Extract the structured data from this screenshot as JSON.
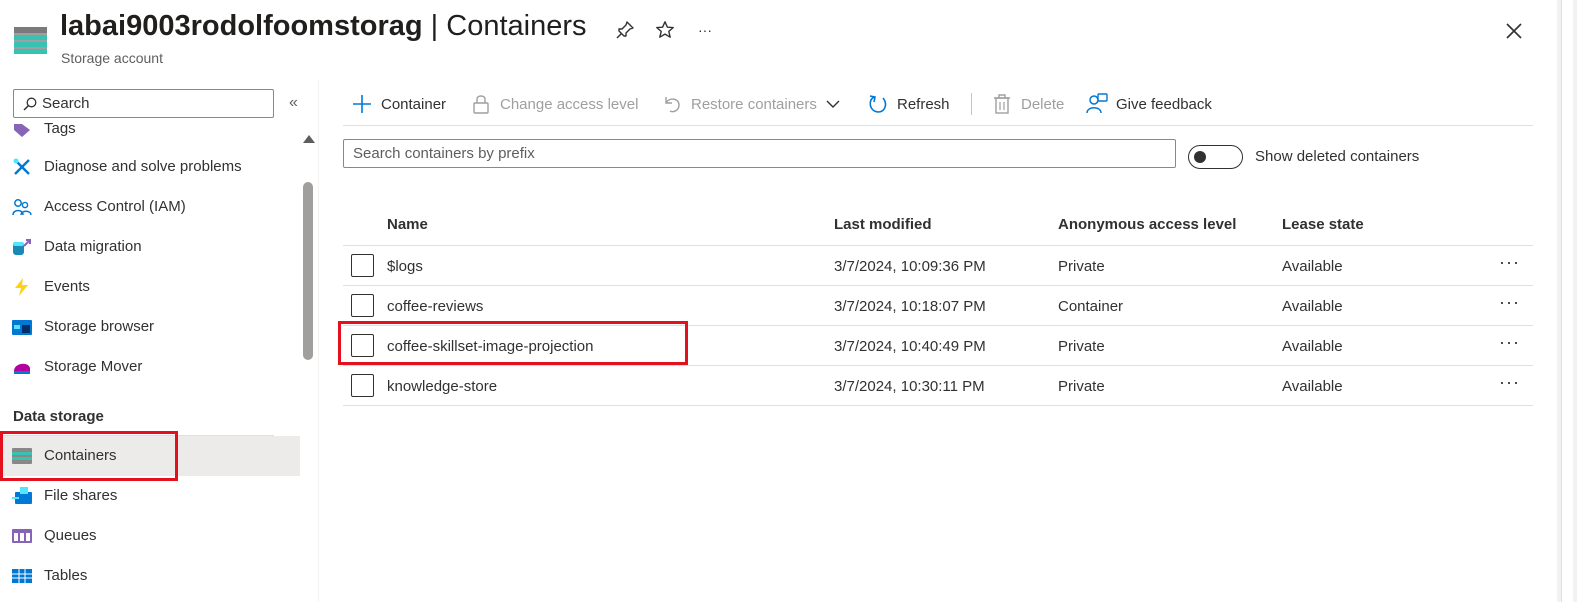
{
  "header": {
    "resource_name": "labai9003rodolfoomstorag",
    "separator": " | ",
    "page_title": "Containers",
    "subtitle": "Storage account",
    "icons": [
      "storage-icon",
      "pin-icon",
      "star-icon",
      "more-icon",
      "close-icon"
    ]
  },
  "sidebar": {
    "search_placeholder": "Search",
    "partial_item": "Tags",
    "items": [
      {
        "label": "Diagnose and solve problems",
        "icon": "wrench-icon"
      },
      {
        "label": "Access Control (IAM)",
        "icon": "people-icon"
      },
      {
        "label": "Data migration",
        "icon": "migration-icon"
      },
      {
        "label": "Events",
        "icon": "lightning-icon"
      },
      {
        "label": "Storage browser",
        "icon": "storage-browser-icon"
      },
      {
        "label": "Storage Mover",
        "icon": "storage-mover-icon"
      }
    ],
    "section_title": "Data storage",
    "data_storage_items": [
      {
        "label": "Containers",
        "icon": "containers-icon",
        "selected": true
      },
      {
        "label": "File shares",
        "icon": "file-shares-icon"
      },
      {
        "label": "Queues",
        "icon": "queues-icon"
      },
      {
        "label": "Tables",
        "icon": "tables-icon"
      }
    ]
  },
  "toolbar": {
    "add_container": "Container",
    "change_access": "Change access level",
    "restore": "Restore containers",
    "refresh": "Refresh",
    "delete": "Delete",
    "feedback": "Give feedback"
  },
  "filter": {
    "prefix_placeholder": "Search containers by prefix",
    "show_deleted_label": "Show deleted containers",
    "show_deleted": false
  },
  "table": {
    "columns": [
      "Name",
      "Last modified",
      "Anonymous access level",
      "Lease state"
    ],
    "rows": [
      {
        "name": "$logs",
        "modified": "3/7/2024, 10:09:36 PM",
        "access": "Private",
        "lease": "Available"
      },
      {
        "name": "coffee-reviews",
        "modified": "3/7/2024, 10:18:07 PM",
        "access": "Container",
        "lease": "Available"
      },
      {
        "name": "coffee-skillset-image-projection",
        "modified": "3/7/2024, 10:40:49 PM",
        "access": "Private",
        "lease": "Available"
      },
      {
        "name": "knowledge-store",
        "modified": "3/7/2024, 10:30:11 PM",
        "access": "Private",
        "lease": "Available"
      }
    ],
    "row_more": "···"
  },
  "colors": {
    "accent": "#0078d4",
    "highlight": "#e3111e",
    "selected_bg": "#edebe9"
  }
}
